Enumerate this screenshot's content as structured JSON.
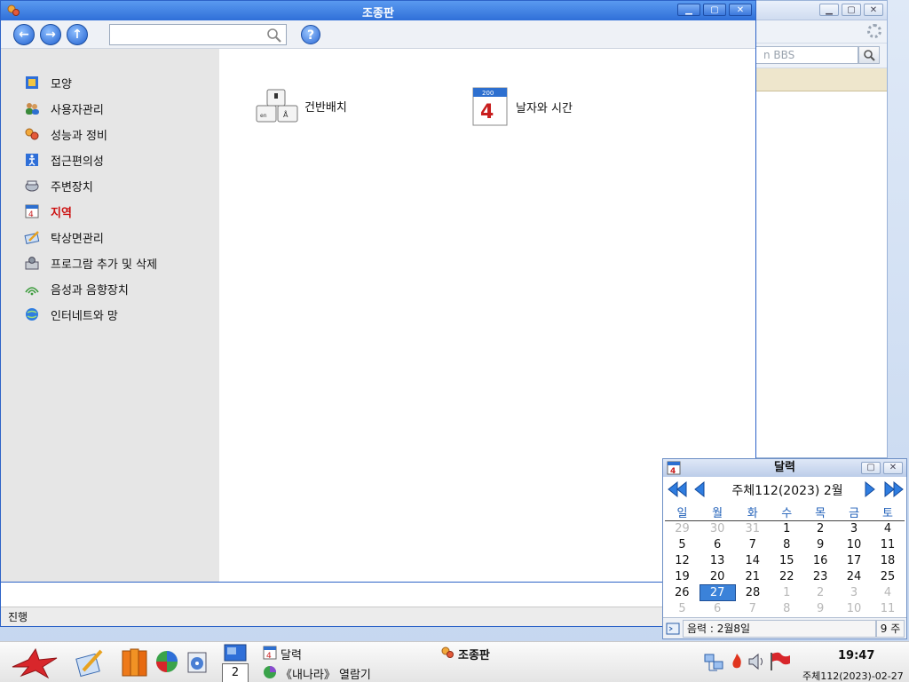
{
  "main_window": {
    "title": "조종판",
    "search": {
      "value": "",
      "placeholder": ""
    },
    "help_label": "?",
    "sidebar": [
      {
        "label": "모양",
        "icon": "appearance-icon",
        "active": false
      },
      {
        "label": "사용자관리",
        "icon": "users-icon",
        "active": false
      },
      {
        "label": "성능과 정비",
        "icon": "performance-icon",
        "active": false
      },
      {
        "label": "접근편의성",
        "icon": "accessibility-icon",
        "active": false
      },
      {
        "label": "주변장치",
        "icon": "peripherals-icon",
        "active": false
      },
      {
        "label": "지역",
        "icon": "region-icon",
        "active": true
      },
      {
        "label": "탁상면관리",
        "icon": "desktop-icon",
        "active": false
      },
      {
        "label": "프로그람 추가 및 삭제",
        "icon": "programs-icon",
        "active": false
      },
      {
        "label": "음성과 음향장치",
        "icon": "sound-icon",
        "active": false
      },
      {
        "label": "인터네트와 망",
        "icon": "network-icon",
        "active": false
      }
    ],
    "content_items": [
      {
        "label": "건반배치",
        "icon": "keyboard-layout-icon"
      },
      {
        "label": "날자와 시간",
        "icon": "date-time-icon"
      }
    ],
    "status_text": "진행"
  },
  "background_window": {
    "address_value": "n BBS"
  },
  "calendar": {
    "title": "달력",
    "year_month": "주체112(2023)  2월",
    "weekdays": [
      "일",
      "월",
      "화",
      "수",
      "목",
      "금",
      "토"
    ],
    "weeks": [
      [
        {
          "d": "29",
          "om": true
        },
        {
          "d": "30",
          "om": true
        },
        {
          "d": "31",
          "om": true
        },
        {
          "d": "1"
        },
        {
          "d": "2"
        },
        {
          "d": "3"
        },
        {
          "d": "4"
        }
      ],
      [
        {
          "d": "5"
        },
        {
          "d": "6"
        },
        {
          "d": "7"
        },
        {
          "d": "8"
        },
        {
          "d": "9"
        },
        {
          "d": "10"
        },
        {
          "d": "11"
        }
      ],
      [
        {
          "d": "12"
        },
        {
          "d": "13"
        },
        {
          "d": "14"
        },
        {
          "d": "15"
        },
        {
          "d": "16"
        },
        {
          "d": "17"
        },
        {
          "d": "18"
        }
      ],
      [
        {
          "d": "19"
        },
        {
          "d": "20"
        },
        {
          "d": "21"
        },
        {
          "d": "22"
        },
        {
          "d": "23"
        },
        {
          "d": "24"
        },
        {
          "d": "25"
        }
      ],
      [
        {
          "d": "26"
        },
        {
          "d": "27",
          "today": true
        },
        {
          "d": "28"
        },
        {
          "d": "1",
          "om": true
        },
        {
          "d": "2",
          "om": true
        },
        {
          "d": "3",
          "om": true
        },
        {
          "d": "4",
          "om": true
        }
      ],
      [
        {
          "d": "5",
          "om": true
        },
        {
          "d": "6",
          "om": true
        },
        {
          "d": "7",
          "om": true
        },
        {
          "d": "8",
          "om": true
        },
        {
          "d": "9",
          "om": true
        },
        {
          "d": "10",
          "om": true
        },
        {
          "d": "11",
          "om": true
        }
      ]
    ],
    "lunar": "음력 : 2월8일",
    "week_no": "9 주"
  },
  "taskbar": {
    "tasks": [
      "달력",
      "조종판",
      "《내나라》 열람기"
    ],
    "workspace": "2",
    "clock": "19:47",
    "date": "주체112(2023)-02-27"
  },
  "colors": {
    "title_blue": "#2f6fd8",
    "active_red": "#cc1010",
    "today_blue": "#3b82d9"
  }
}
